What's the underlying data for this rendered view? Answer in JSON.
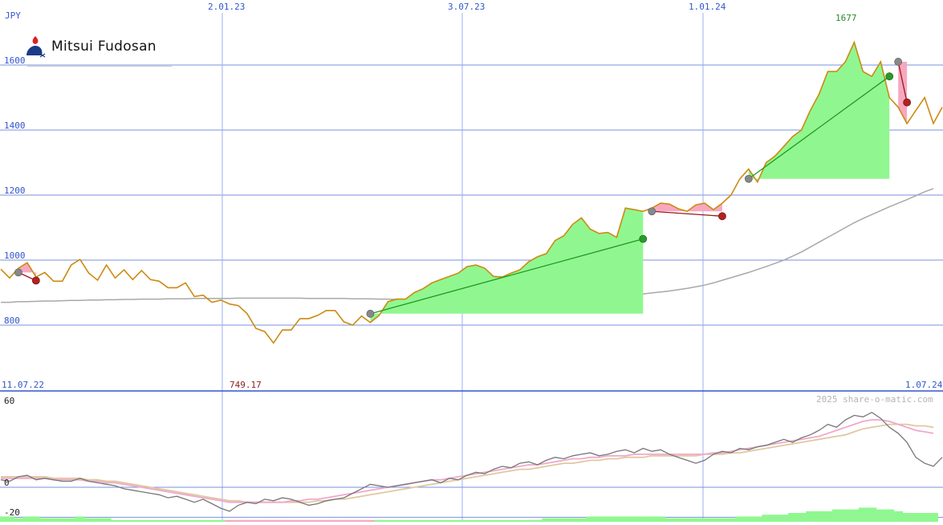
{
  "header": {
    "currency": "JPY",
    "logo_text": "Mitsui Fudosan",
    "credit": "2025 share-o-matic.com"
  },
  "colors": {
    "price": "#cc8a12",
    "ma_long": "#a8a8a8",
    "gain_fill": "#90f790",
    "loss_fill": "#f7a8c0",
    "grid": "#7890dd",
    "win_line": "#229922",
    "loss_line": "#991a1a",
    "osc_dark": "#777777",
    "osc_pink": "#f0a8cc",
    "osc_tan": "#e0c8a0"
  },
  "chart_data": [
    {
      "type": "line",
      "title": "",
      "ylabel": "JPY",
      "ylim": [
        700,
        1700
      ],
      "y_ticks": [
        800,
        1000,
        1200,
        1400,
        1600
      ],
      "x_range": [
        "11.07.22",
        "1.07.24"
      ],
      "x_ticks": [
        "2.01.23",
        "3.07.23",
        "1.01.24"
      ],
      "start_label": "11.07.22",
      "end_label": "1.07.24",
      "high_label": "1677",
      "low_label": "749.17",
      "series": [
        {
          "values": [
            972,
            945,
            975,
            992,
            948,
            962,
            935,
            935,
            985,
            1002,
            960,
            938,
            985,
            945,
            970,
            940,
            968,
            940,
            935,
            915,
            915,
            930,
            888,
            892,
            870,
            877,
            865,
            860,
            835,
            790,
            780,
            745,
            785,
            785,
            820,
            820,
            830,
            845,
            845,
            810,
            800,
            828,
            808,
            830,
            872,
            880,
            880,
            900,
            912,
            930,
            940,
            950,
            960,
            980,
            985,
            975,
            950,
            948,
            960,
            970,
            995,
            1010,
            1020,
            1060,
            1075,
            1110,
            1130,
            1095,
            1082,
            1085,
            1070,
            1160,
            1155,
            1150,
            1160,
            1175,
            1172,
            1158,
            1150,
            1170,
            1175,
            1155,
            1175,
            1200,
            1250,
            1280,
            1240,
            1300,
            1320,
            1350,
            1380,
            1400,
            1460,
            1510,
            1580,
            1580,
            1610,
            1670,
            1580,
            1565,
            1610,
            1500,
            1470,
            1420,
            1460,
            1500,
            1420,
            1470
          ]
        },
        {
          "values": [
            870,
            870,
            872,
            872,
            873,
            874,
            874,
            875,
            876,
            876,
            877,
            877,
            878,
            878,
            879,
            879,
            880,
            880,
            880,
            881,
            881,
            881,
            882,
            882,
            882,
            882,
            882,
            883,
            883,
            883,
            883,
            883,
            883,
            883,
            883,
            882,
            882,
            882,
            882,
            882,
            881,
            881,
            881,
            880,
            880,
            879,
            879,
            878,
            878,
            877,
            876,
            875,
            874,
            873,
            873,
            872,
            872,
            872,
            872,
            872,
            872,
            873,
            873,
            874,
            875,
            876,
            878,
            880,
            882,
            884,
            887,
            890,
            893,
            896,
            899,
            902,
            905,
            909,
            913,
            918,
            923,
            930,
            938,
            946,
            954,
            962,
            971,
            980,
            990,
            1000,
            1012,
            1025,
            1040,
            1055,
            1070,
            1085,
            1100,
            1115,
            1128,
            1140,
            1152,
            1164,
            1175,
            1186,
            1198,
            1210,
            1220
          ]
        }
      ],
      "trades": [
        {
          "from": [
            2,
            962
          ],
          "to": [
            4,
            937
          ],
          "result": "loss"
        },
        {
          "from": [
            42,
            835
          ],
          "to": [
            73,
            1065
          ],
          "result": "win"
        },
        {
          "from": [
            74,
            1150
          ],
          "to": [
            82,
            1135
          ],
          "result": "loss"
        },
        {
          "from": [
            85,
            1250
          ],
          "to": [
            101,
            1565
          ],
          "result": "win"
        },
        {
          "from": [
            102,
            1610
          ],
          "to": [
            103,
            1485
          ],
          "result": "loss"
        }
      ]
    },
    {
      "type": "line",
      "ylim": [
        -20,
        60
      ],
      "y_ticks": [
        60,
        0,
        -20
      ],
      "series": [
        {
          "values": [
            5,
            4,
            7,
            8,
            5,
            6,
            5,
            4,
            4,
            6,
            4,
            3,
            2,
            1,
            -1,
            -2,
            -3,
            -4,
            -5,
            -7,
            -6,
            -8,
            -10,
            -8,
            -11,
            -14,
            -16,
            -12,
            -10,
            -11,
            -8,
            -9,
            -7,
            -8,
            -10,
            -12,
            -11,
            -9,
            -8,
            -7,
            -4,
            -1,
            2,
            1,
            0,
            1,
            2,
            3,
            4,
            5,
            3,
            6,
            5,
            8,
            10,
            9,
            12,
            14,
            13,
            16,
            17,
            15,
            18,
            20,
            19,
            21,
            22,
            23,
            21,
            22,
            24,
            25,
            23,
            26,
            24,
            25,
            22,
            20,
            18,
            16,
            18,
            22,
            24,
            23,
            26,
            25,
            27,
            28,
            30,
            32,
            30,
            33,
            35,
            38,
            42,
            40,
            45,
            48,
            47,
            50,
            46,
            40,
            36,
            30,
            20,
            16,
            14,
            20
          ]
        },
        {
          "values": [
            6,
            6,
            6,
            6,
            6,
            6,
            5,
            5,
            5,
            5,
            4,
            4,
            3,
            3,
            2,
            1,
            0,
            -1,
            -2,
            -3,
            -4,
            -5,
            -6,
            -7,
            -8,
            -9,
            -10,
            -10,
            -10,
            -10,
            -10,
            -10,
            -10,
            -9,
            -9,
            -8,
            -8,
            -7,
            -6,
            -5,
            -4,
            -3,
            -2,
            -1,
            0,
            1,
            2,
            3,
            4,
            5,
            5,
            6,
            7,
            8,
            9,
            10,
            11,
            12,
            13,
            14,
            15,
            15,
            16,
            17,
            18,
            19,
            19,
            20,
            20,
            21,
            21,
            21,
            22,
            22,
            22,
            22,
            22,
            22,
            22,
            22,
            22,
            23,
            23,
            24,
            25,
            26,
            27,
            28,
            29,
            30,
            31,
            32,
            33,
            34,
            36,
            38,
            40,
            42,
            44,
            45,
            45,
            44,
            42,
            40,
            38,
            37,
            36
          ]
        },
        {
          "values": [
            7,
            7,
            7,
            7,
            7,
            7,
            6,
            6,
            6,
            6,
            5,
            5,
            4,
            4,
            3,
            2,
            1,
            0,
            -1,
            -2,
            -3,
            -4,
            -5,
            -6,
            -7,
            -8,
            -9,
            -9,
            -10,
            -10,
            -10,
            -10,
            -10,
            -10,
            -10,
            -10,
            -9,
            -9,
            -8,
            -8,
            -7,
            -6,
            -5,
            -4,
            -3,
            -2,
            -1,
            0,
            1,
            2,
            3,
            4,
            5,
            6,
            7,
            8,
            9,
            10,
            11,
            12,
            12,
            13,
            14,
            15,
            16,
            16,
            17,
            18,
            18,
            19,
            19,
            20,
            20,
            20,
            21,
            21,
            21,
            21,
            21,
            21,
            22,
            22,
            22,
            23,
            23,
            24,
            25,
            26,
            27,
            28,
            29,
            30,
            31,
            32,
            33,
            34,
            35,
            37,
            39,
            40,
            41,
            42,
            42,
            42,
            41,
            41,
            40
          ]
        }
      ],
      "bars": [
        3,
        3,
        2,
        3,
        3,
        2,
        2,
        2,
        2,
        3,
        2,
        2,
        2,
        1,
        1,
        1,
        1,
        1,
        1,
        1,
        1,
        1,
        1,
        1,
        1,
        1,
        -1,
        -1,
        -1,
        -1,
        -1,
        -1,
        -1,
        -1,
        -1,
        -1,
        -1,
        -1,
        -1,
        -1,
        -1,
        -1,
        -1,
        1,
        1,
        1,
        1,
        1,
        1,
        1,
        1,
        1,
        1,
        1,
        1,
        1,
        1,
        1,
        1,
        1,
        1,
        1,
        2,
        2,
        2,
        2,
        2,
        3,
        3,
        3,
        3,
        3,
        3,
        3,
        3,
        3,
        2,
        2,
        2,
        2,
        2,
        2,
        2,
        2,
        3,
        3,
        3,
        4,
        4,
        4,
        5,
        5,
        6,
        6,
        6,
        7,
        7,
        7,
        8,
        8,
        7,
        7,
        6,
        5,
        5,
        5,
        5
      ]
    }
  ]
}
